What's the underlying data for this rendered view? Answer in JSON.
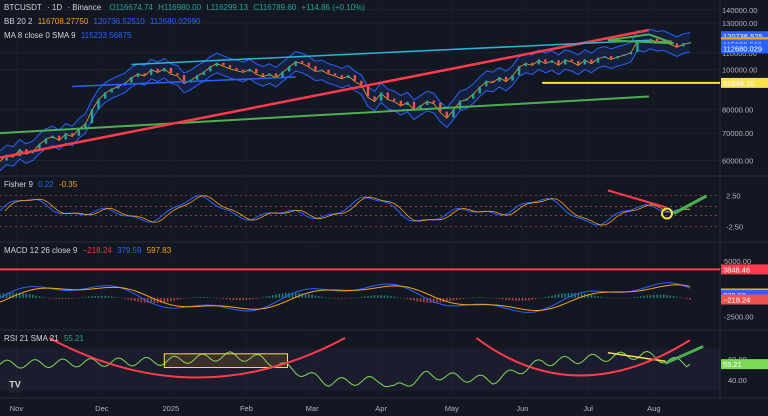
{
  "header": {
    "symbol": "BTCUSDT",
    "interval": "1D",
    "exchange": "Binance",
    "ohlc": {
      "o": "O116674.74",
      "h": "H116980.00",
      "l": "L116299.13",
      "c": "C116789.60",
      "chg": "+114.86 (+0.10%)"
    }
  },
  "bb_legend": {
    "name": "BB 20 2",
    "basis": "116708.27750",
    "upper": "120736.52510",
    "lower": "112680.02990"
  },
  "ma_legend": {
    "name": "MA 8 close 0 SMA 9",
    "value": "115233.56875"
  },
  "fisher_legend": {
    "name": "Fisher 9",
    "v1": "0.22",
    "v2": "-0.35"
  },
  "macd_legend": {
    "name": "MACD 12 26 close 9",
    "hist": "−218.24",
    "macd": "379.59",
    "signal": "597.83"
  },
  "rsi_legend": {
    "name": "RSI 21 SMA 21",
    "value": "55.21"
  },
  "colors": {
    "bg": "#131722",
    "up": "#26a69a",
    "down": "#ef5350",
    "price": "#2b6f4f",
    "bb": "#2962ff",
    "yellow": "#f7e24a",
    "red": "#ff3b4e",
    "green": "#4caf50",
    "cyan": "#2bb3d8",
    "rsi": "#7ed957"
  },
  "chart_data": [
    {
      "type": "line",
      "title": "BTCUSDT · 1D · Binance",
      "y_ticks": [
        "140000.00",
        "130000.00",
        "110000.00",
        "100000.00",
        "80000.00",
        "70000.00",
        "60000.00"
      ],
      "y_scale": "log",
      "ylim": [
        55000,
        148000
      ],
      "x_ticks": [
        "Nov",
        "Dec",
        "2025",
        "Feb",
        "Mar",
        "Apr",
        "May",
        "Jun",
        "Jul",
        "Aug"
      ],
      "price_labels": [
        {
          "value": "120736.525",
          "v": 120736,
          "color": "#2962ff"
        },
        {
          "value": "116789.60",
          "v": 116790,
          "color": "#26a69a"
        },
        {
          "value": "116708.277",
          "v": 116708,
          "color": "#f7a21b"
        },
        {
          "value": "115233.568",
          "v": 115233,
          "color": "#2962ff"
        },
        {
          "value": "112680.029",
          "v": 112680,
          "color": "#2962ff"
        },
        {
          "value": "92849.10",
          "v": 92849,
          "color": "#f7e24a"
        }
      ],
      "series": [
        {
          "values": [
            [
              0,
              60000
            ],
            [
              4,
              62000
            ],
            [
              8,
              61500
            ],
            [
              12,
              64000
            ],
            [
              16,
              62500
            ],
            [
              20,
              63500
            ],
            [
              24,
              66000
            ],
            [
              28,
              68000
            ],
            [
              32,
              69000
            ],
            [
              36,
              67500
            ],
            [
              40,
              70000
            ],
            [
              44,
              69000
            ],
            [
              48,
              72000
            ],
            [
              52,
              74000
            ],
            [
              56,
              80000
            ],
            [
              60,
              85000
            ],
            [
              64,
              88000
            ],
            [
              68,
              90000
            ],
            [
              72,
              91500
            ],
            [
              76,
              93000
            ],
            [
              80,
              96000
            ],
            [
              84,
              98000
            ],
            [
              88,
              97000
            ],
            [
              92,
              100500
            ],
            [
              96,
              99000
            ],
            [
              100,
              101000
            ],
            [
              104,
              98000
            ],
            [
              108,
              97000
            ],
            [
              112,
              93000
            ],
            [
              116,
              94500
            ],
            [
              120,
              97000
            ],
            [
              124,
              99000
            ],
            [
              128,
              102000
            ],
            [
              132,
              104000
            ],
            [
              136,
              102500
            ],
            [
              140,
              101000
            ],
            [
              144,
              100000
            ],
            [
              148,
              99000
            ],
            [
              152,
              100500
            ],
            [
              156,
              98000
            ],
            [
              160,
              96500
            ],
            [
              164,
              98000
            ],
            [
              168,
              96000
            ],
            [
              172,
              99000
            ],
            [
              176,
              102000
            ],
            [
              180,
              105000
            ],
            [
              184,
              104000
            ],
            [
              188,
              102000
            ],
            [
              192,
              99500
            ],
            [
              196,
              100000
            ],
            [
              200,
              98000
            ],
            [
              204,
              97000
            ],
            [
              208,
              95500
            ],
            [
              212,
              97000
            ],
            [
              216,
              94000
            ],
            [
              220,
              92000
            ],
            [
              224,
              86000
            ],
            [
              228,
              84000
            ],
            [
              232,
              88000
            ],
            [
              236,
              85000
            ],
            [
              240,
              84000
            ],
            [
              244,
              82000
            ],
            [
              248,
              83500
            ],
            [
              252,
              80000
            ],
            [
              256,
              82000
            ],
            [
              260,
              84000
            ],
            [
              264,
              83000
            ],
            [
              268,
              79000
            ],
            [
              272,
              76500
            ],
            [
              276,
              80000
            ],
            [
              280,
              84000
            ],
            [
              284,
              85000
            ],
            [
              288,
              87500
            ],
            [
              292,
              91000
            ],
            [
              296,
              94000
            ],
            [
              300,
              93500
            ],
            [
              304,
              96000
            ],
            [
              308,
              94000
            ],
            [
              312,
              97000
            ],
            [
              316,
              102000
            ],
            [
              320,
              104000
            ],
            [
              324,
              103000
            ],
            [
              328,
              106000
            ],
            [
              332,
              104000
            ],
            [
              336,
              105500
            ],
            [
              340,
              103000
            ],
            [
              344,
              106000
            ],
            [
              348,
              105000
            ],
            [
              352,
              103000
            ],
            [
              356,
              106000
            ],
            [
              360,
              104000
            ],
            [
              364,
              107000
            ],
            [
              368,
              108000
            ],
            [
              372,
              106500
            ],
            [
              376,
              108000
            ],
            [
              380,
              109000
            ],
            [
              384,
              110500
            ],
            [
              388,
              118000
            ],
            [
              392,
              117000
            ],
            [
              396,
              119000
            ],
            [
              400,
              117500
            ],
            [
              404,
              118000
            ],
            [
              408,
              116000
            ],
            [
              412,
              114000
            ],
            [
              416,
              116000
            ],
            [
              420,
              116789
            ]
          ]
        }
      ]
    },
    {
      "type": "line",
      "title": "Fisher 9",
      "y_ticks": [
        "2.50",
        "-2.50"
      ],
      "ylim": [
        -4,
        4
      ],
      "series": [
        {
          "values": [
            [
              0,
              0.5
            ],
            [
              420,
              0.22
            ]
          ]
        }
      ]
    },
    {
      "type": "bar",
      "title": "MACD 12 26 close 9",
      "y_ticks": [
        "5000.00",
        "-2500.00"
      ],
      "ylim": [
        -3800,
        6200
      ],
      "price_labels": [
        {
          "value": "3848.46",
          "v": 3848,
          "color": "#ff3b4e"
        },
        {
          "value": "597.83",
          "v": 598,
          "color": "#f7a21b"
        },
        {
          "value": "379.59",
          "v": 380,
          "color": "#2962ff"
        },
        {
          "value": "−218.24",
          "v": -218,
          "color": "#ef5350"
        }
      ],
      "series": [
        {
          "values": [
            [
              0,
              0
            ],
            [
              420,
              -218.24
            ]
          ]
        }
      ]
    },
    {
      "type": "line",
      "title": "RSI 21 SMA 21",
      "y_ticks": [
        "60.00",
        "40.00"
      ],
      "ylim": [
        25,
        80
      ],
      "price_labels": [
        {
          "value": "55.21",
          "v": 55.21,
          "color": "#7ed957"
        }
      ],
      "series": [
        {
          "values": [
            [
              0,
              55
            ],
            [
              100,
              58
            ],
            [
              140,
              63
            ],
            [
              160,
              60
            ],
            [
              200,
              38
            ],
            [
              232,
              40
            ],
            [
              240,
              32
            ],
            [
              260,
              45
            ],
            [
              300,
              40
            ],
            [
              330,
              57
            ],
            [
              380,
              63
            ],
            [
              392,
              64
            ],
            [
              410,
              58
            ],
            [
              420,
              55.21
            ]
          ]
        }
      ]
    }
  ]
}
